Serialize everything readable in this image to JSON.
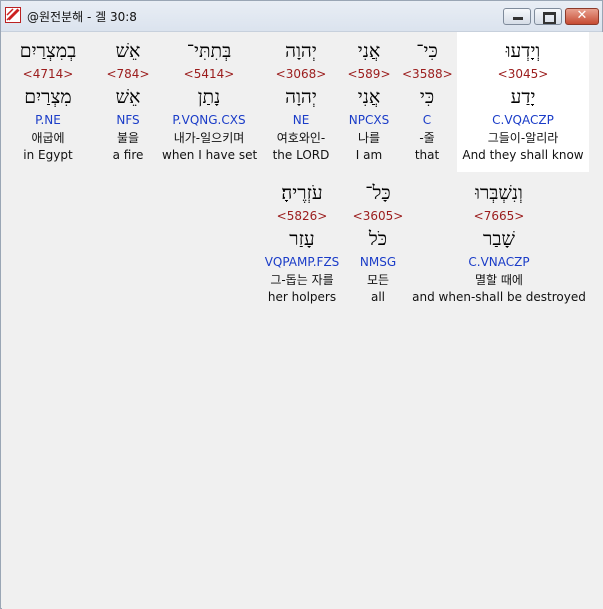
{
  "window": {
    "title": "@원전분해 - 겔 30:8"
  },
  "rows": [
    [
      {
        "heb": "בְמִצְרַיִם",
        "num": "<4714>",
        "lemma": "מִצְרַיִם",
        "parse": "P.NE",
        "kor": "애굽에",
        "eng": "in Egypt"
      },
      {
        "heb": "אֵשׁ",
        "num": "<784>",
        "lemma": "אֵשׁ",
        "parse": "NFS",
        "kor": "불을",
        "eng": "a fire"
      },
      {
        "heb": "בְּתִתִּי־",
        "num": "<5414>",
        "lemma": "נָתַן",
        "parse": "P.VQNG.CXS",
        "kor": "내가-일으키며",
        "eng": "when I have set"
      },
      {
        "heb": "יְהוָה",
        "num": "<3068>",
        "lemma": "יְהוָה",
        "parse": "NE",
        "kor": "여호와인-",
        "eng": "the LORD"
      },
      {
        "heb": "אֲנִי",
        "num": "<589>",
        "lemma": "אֲנִי",
        "parse": "NPCXS",
        "kor": "나를",
        "eng": "I am"
      },
      {
        "heb": "כִּי־",
        "num": "<3588>",
        "lemma": "כִּי",
        "parse": "C",
        "kor": "-줄",
        "eng": "that"
      },
      {
        "heb": "וְיָדְעוּ",
        "num": "<3045>",
        "lemma": "יָדַע",
        "parse": "C.VQACZP",
        "kor": "그들이-알리라",
        "eng": "And they shall know"
      }
    ],
    [
      {
        "heb": "עֹזְרֶיהָ׃",
        "num": "<5826>",
        "lemma": "עָזַר",
        "parse": "VQPAMP.FZS",
        "kor": "그-돕는 자를",
        "eng": "her holpers"
      },
      {
        "heb": "כָּל־",
        "num": "<3605>",
        "lemma": "כֹּל",
        "parse": "NMSG",
        "kor": "모든",
        "eng": "all"
      },
      {
        "heb": "וְנִשְׁבְּרוּ",
        "num": "<7665>",
        "lemma": "שָׁבַר",
        "parse": "C.VNACZP",
        "kor": "멸할 때에",
        "eng": "and when-shall be destroyed"
      }
    ]
  ]
}
